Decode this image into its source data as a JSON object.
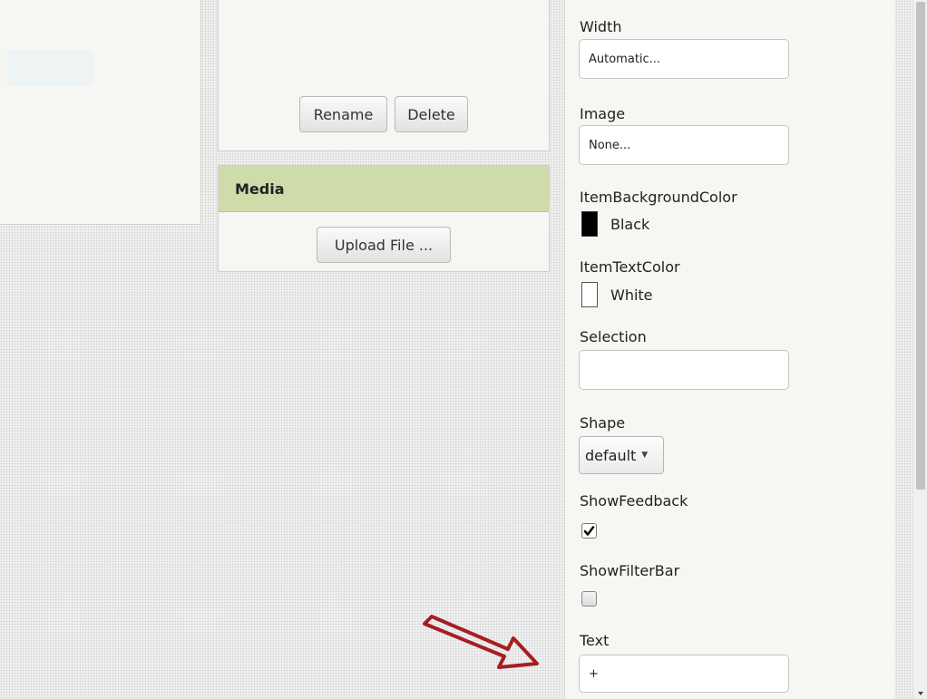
{
  "components_panel": {
    "rename_label": "Rename",
    "delete_label": "Delete"
  },
  "media_panel": {
    "title": "Media",
    "upload_label": "Upload File ..."
  },
  "properties": {
    "width": {
      "label": "Width",
      "value": "Automatic..."
    },
    "image": {
      "label": "Image",
      "value": "None..."
    },
    "item_background_color": {
      "label": "ItemBackgroundColor",
      "value": "Black",
      "swatch": "#000000"
    },
    "item_text_color": {
      "label": "ItemTextColor",
      "value": "White",
      "swatch": "#FFFFFF"
    },
    "selection": {
      "label": "Selection",
      "value": ""
    },
    "shape": {
      "label": "Shape",
      "value": "default"
    },
    "show_feedback": {
      "label": "ShowFeedback",
      "checked": true
    },
    "show_filter_bar": {
      "label": "ShowFilterBar",
      "checked": false
    },
    "text": {
      "label": "Text",
      "value": "+"
    }
  },
  "colors": {
    "media_header": "#CEDCAA",
    "panel_background": "#F6F7F2",
    "annotation_arrow": "#A61E22"
  },
  "icons": [
    "checkmark-icon",
    "dropdown-caret-icon",
    "annotation-arrow-icon"
  ]
}
